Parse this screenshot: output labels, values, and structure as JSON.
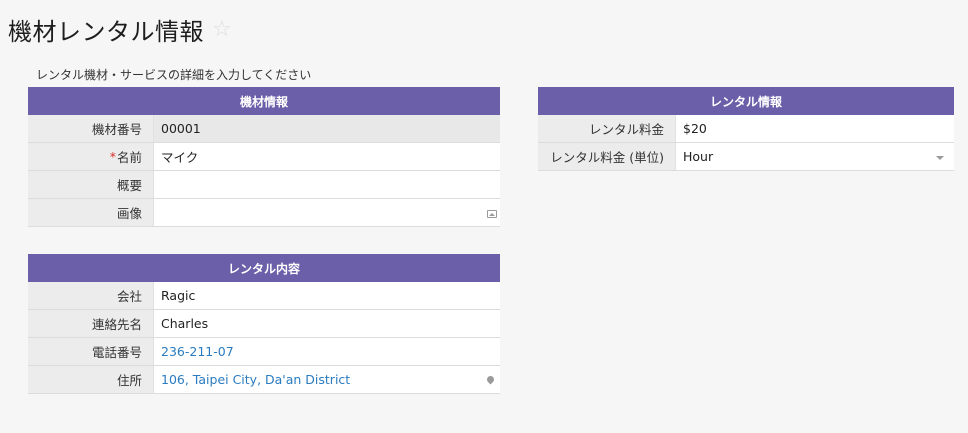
{
  "title": "機材レンタル情報",
  "subtitle": "レンタル機材・サービスの詳細を入力してください",
  "sections": {
    "equipment": {
      "header": "機材情報",
      "rows": [
        {
          "label": "機材番号",
          "value": "00001"
        },
        {
          "label": "名前",
          "value": "マイク",
          "required_mark": "*"
        },
        {
          "label": "概要",
          "value": ""
        },
        {
          "label": "画像",
          "value": ""
        }
      ]
    },
    "rental": {
      "header": "レンタル内容",
      "rows": [
        {
          "label": "会社",
          "value": "Ragic"
        },
        {
          "label": "連絡先名",
          "value": "Charles"
        },
        {
          "label": "電話番号",
          "value": "236-211-07"
        },
        {
          "label": "住所",
          "value": "106, Taipei City, Da'an District"
        }
      ]
    },
    "pricing": {
      "header": "レンタル情報",
      "rows": [
        {
          "label": "レンタル料金",
          "value": "$20"
        },
        {
          "label": "レンタル料金 (単位)",
          "value": "Hour"
        }
      ]
    }
  },
  "colors": {
    "header_bg": "#6b5fa9",
    "link": "#2a7bc0",
    "required": "#d92d2d"
  },
  "icons": [
    "star-icon",
    "image-icon",
    "map-pin-icon",
    "dropdown-caret-icon"
  ]
}
